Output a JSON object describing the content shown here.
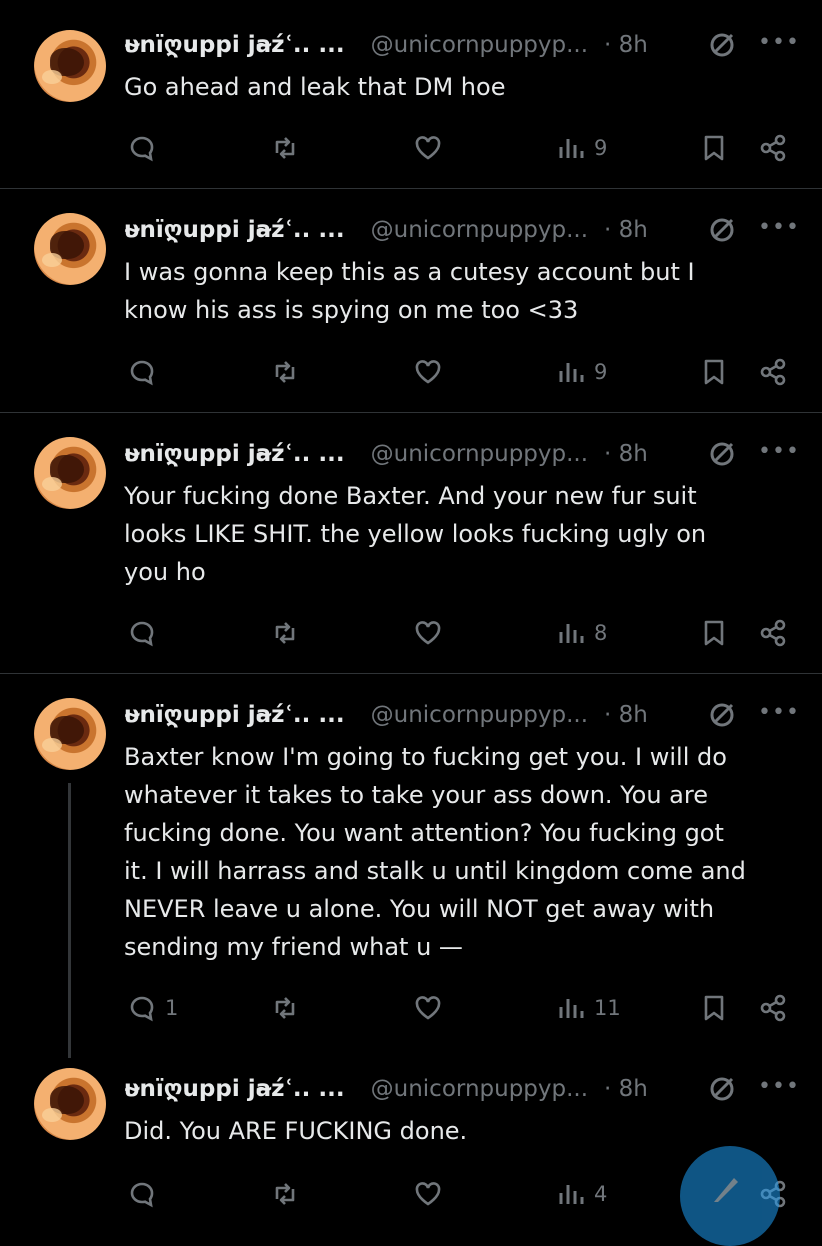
{
  "icons": {
    "reply": "reply-bubble-icon",
    "repost": "repost-arrows-icon",
    "like": "heart-icon",
    "views": "bar-chart-icon",
    "bookmark": "bookmark-icon",
    "share": "share-icon",
    "muted": "no-entry-icon",
    "more": "more-dots-icon"
  },
  "posts": [
    {
      "name": "υ̴nїღuppi ja̴źʿ.. ...",
      "handle": "@unicornpuppyp...",
      "time": "· 8h",
      "text": "Go ahead and leak that DM hoe",
      "replies": "",
      "views": "9"
    },
    {
      "name": "υ̴nїღuppi ja̴źʿ.. ...",
      "handle": "@unicornpuppyp...",
      "time": "· 8h",
      "text": "I was gonna keep this as a cutesy account but I\nknow his ass is spying on me too <33",
      "replies": "",
      "views": "9"
    },
    {
      "name": "υ̴nїღuppi ja̴źʿ.. ...",
      "handle": "@unicornpuppyp...",
      "time": "· 8h",
      "text": "Your fucking done Baxter. And your new fur suit\nlooks LIKE SHIT. the yellow looks fucking ugly on\nyou ho",
      "replies": "",
      "views": "8"
    },
    {
      "name": "υ̴nїღuppi ja̴źʿ.. ...",
      "handle": "@unicornpuppyp...",
      "time": "· 8h",
      "text": "Baxter know I'm going to fucking get you. I will do\nwhatever it takes to take your ass down. You are\nfucking done. You want attention? You fucking got\nit. I will harrass and stalk u until kingdom come and\nNEVER leave u alone. You will NOT get away with\nsending my friend what u —",
      "replies": "1",
      "views": "11"
    },
    {
      "name": "υ̴nїღuppi ja̴źʿ.. ...",
      "handle": "@unicornpuppyp...",
      "time": "· 8h",
      "text": "Did. You ARE FUCKING done.",
      "replies": "",
      "views": "4"
    }
  ],
  "colors": {
    "background": "#000000",
    "text": "#e7e9ea",
    "muted": "#71767b",
    "divider": "#2f3336",
    "accent": "#1d9bf0"
  }
}
